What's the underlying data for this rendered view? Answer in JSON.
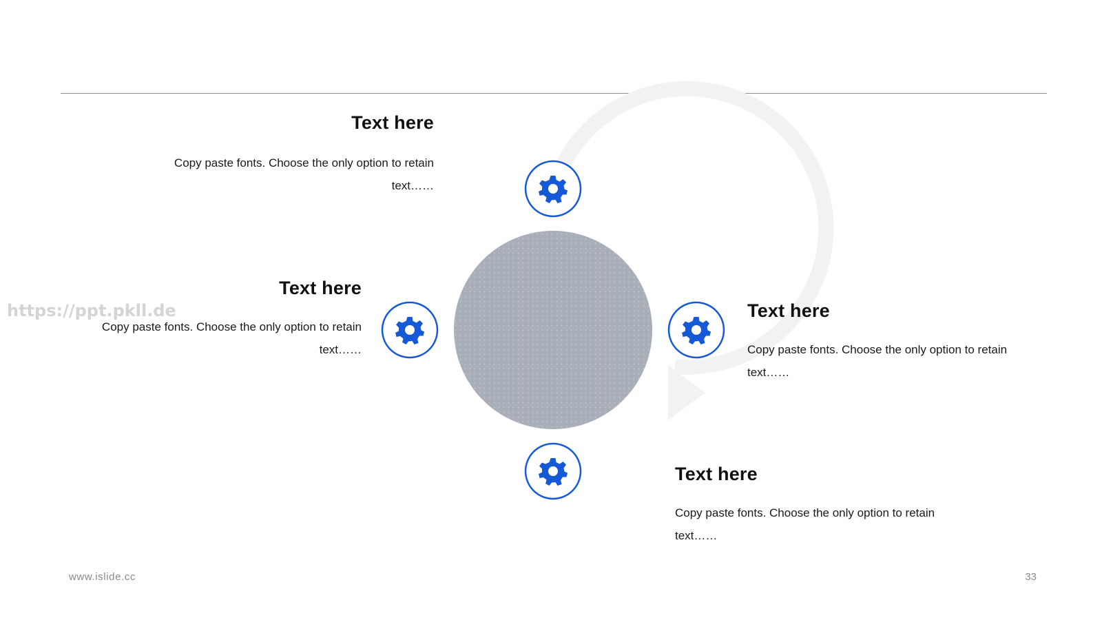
{
  "blocks": {
    "top": {
      "title": "Text here",
      "body": "Copy paste fonts. Choose the only option to retain text……"
    },
    "left": {
      "title": "Text here",
      "body": "Copy paste fonts. Choose the only option to retain text……"
    },
    "right": {
      "title": "Text here",
      "body": "Copy paste fonts. Choose the only option to retain text……"
    },
    "bottom": {
      "title": "Text here",
      "body": "Copy paste fonts. Choose the only option to retain text……"
    }
  },
  "nodes": [
    {
      "id": "top",
      "icon": "gear-icon"
    },
    {
      "id": "left",
      "icon": "gear-icon"
    },
    {
      "id": "right",
      "icon": "gear-icon"
    },
    {
      "id": "bottom",
      "icon": "gear-icon"
    }
  ],
  "watermark": "https://ppt.pkll.de",
  "footer": {
    "website": "www.islide.cc",
    "page_number": "33"
  },
  "colors": {
    "accent": "#1559d6",
    "ring": "#f1f2f4",
    "center": "#a9afb8"
  }
}
